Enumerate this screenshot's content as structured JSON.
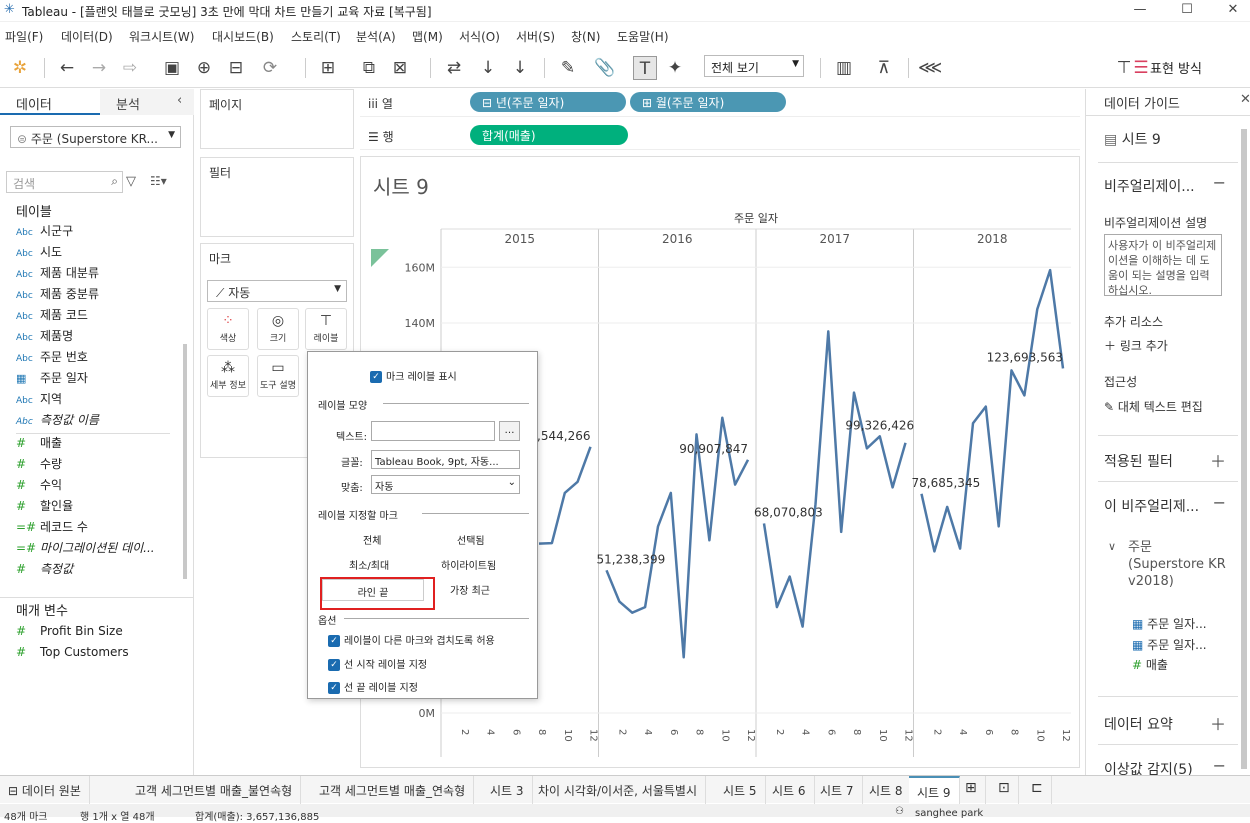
{
  "window": {
    "title": "Tableau - [플랜잇 태블로 굿모닝] 3초 만에 막대 차트 만들기 교육 자료 [복구됨]",
    "minimize": "—",
    "maximize": "☐",
    "close": "✕"
  },
  "menu": [
    "파일(F)",
    "데이터(D)",
    "워크시트(W)",
    "대시보드(B)",
    "스토리(T)",
    "분석(A)",
    "맵(M)",
    "서식(O)",
    "서버(S)",
    "창(N)",
    "도움말(H)"
  ],
  "toolbar": {
    "view_select": "전체 보기",
    "presentation": "표현 방식"
  },
  "left": {
    "tab_data": "데이터",
    "tab_analysis": "분석",
    "datasource": "주문 (Superstore KR...",
    "search_placeholder": "검색",
    "tables_header": "테이블",
    "fields": [
      {
        "type": "Abc",
        "name": "시군구"
      },
      {
        "type": "Abc",
        "name": "시도"
      },
      {
        "type": "Abc",
        "name": "제품 대분류"
      },
      {
        "type": "Abc",
        "name": "제품 중분류"
      },
      {
        "type": "Abc",
        "name": "제품 코드"
      },
      {
        "type": "Abc",
        "name": "제품명"
      },
      {
        "type": "Abc",
        "name": "주문 번호"
      },
      {
        "type": "cal",
        "name": "주문 일자"
      },
      {
        "type": "Abc",
        "name": "지역"
      },
      {
        "type": "Abc",
        "name": "측정값 이름"
      },
      {
        "type": "#",
        "name": "매출"
      },
      {
        "type": "#",
        "name": "수량"
      },
      {
        "type": "#",
        "name": "수익"
      },
      {
        "type": "#",
        "name": "할인율"
      },
      {
        "type": "=#",
        "name": "레코드 수"
      },
      {
        "type": "=#",
        "name": "마이그레이션된 데이..."
      },
      {
        "type": "#",
        "name": "측정값"
      }
    ],
    "params_header": "매개 변수",
    "params": [
      "Profit Bin Size",
      "Top Customers"
    ]
  },
  "panels": {
    "pages": "페이지",
    "filters": "필터",
    "marks": "마크",
    "mark_type": "자동",
    "mark_buttons": [
      "색상",
      "크기",
      "레이블",
      "세부 정보",
      "도구 설명"
    ]
  },
  "shelves": {
    "columns_label": "열",
    "rows_label": "행",
    "columns_pills": [
      "년(주문 일자)",
      "월(주문 일자)"
    ],
    "rows_pills": [
      "합계(매출)"
    ]
  },
  "sheet": {
    "title": "시트 9"
  },
  "popup": {
    "show_labels": "마크 레이블 표시",
    "appearance_header": "레이블 모양",
    "text_label": "텍스트:",
    "font_label": "글꼴:",
    "font_value": "Tableau Book, 9pt, 자동...",
    "align_label": "맞춤:",
    "align_value": "자동",
    "marks_header": "레이블 지정할 마크",
    "opt_all": "전체",
    "opt_selected": "선택됨",
    "opt_minmax": "최소/최대",
    "opt_highlighted": "하이라이트됨",
    "opt_lineend": "라인 끝",
    "opt_recent": "가장 최근",
    "options_header": "옵션",
    "opt1": "레이블이 다른 마크와 겹치도록 허용",
    "opt2": "선 시작 레이블 지정",
    "opt3": "선 끝 레이블 지정"
  },
  "right": {
    "title": "데이터 가이드",
    "sheet_name": "시트 9",
    "viz_header": "비주얼리제이...",
    "desc_label": "비주얼리제이션 설명",
    "desc_text": "사용자가 이 비주얼리제이션을 이해하는 데 도움이 되는 설명을 입력하십시오.",
    "resources_label": "추가 리소스",
    "add_link": "링크 추가",
    "access_label": "접근성",
    "alt_text": "대체 텍스트 편집",
    "applied_filters": "적용된 필터",
    "this_viz": "이 비주얼리제...",
    "ds_name": "주문 (Superstore KR v2018)",
    "ds_fields": [
      "주문 일자...",
      "주문 일자...",
      "매출"
    ],
    "data_summary": "데이터 요약",
    "outliers": "이상값 감지(5)"
  },
  "bottom_tabs": [
    "데이터 원본",
    "고객 세그먼트별 매출_불연속형",
    "고객 세그먼트별 매출_연속형",
    "시트 3",
    "차이 시각화/이서준, 서울특별시",
    "시트 5",
    "시트 6",
    "시트 7",
    "시트 8",
    "시트 9"
  ],
  "status": {
    "marks": "48개 마크",
    "rows": "행 1개 x 열 48개",
    "sum": "합계(매출): 3,657,136,885",
    "user": "sanghee park"
  },
  "colors": {
    "line": "#4e79a7",
    "pill_dim": "#4b97b3",
    "pill_measure": "#00b07d",
    "highlight_box": "#e02020",
    "checkbox": "#1a6bb0"
  },
  "chart_data": {
    "type": "line",
    "title": "시트 9",
    "xlabel": "주문 일자",
    "years": [
      "2015",
      "2016",
      "2017",
      "2018"
    ],
    "month_ticks": [
      "2",
      "4",
      "6",
      "8",
      "10",
      "12"
    ],
    "y_ticks": [
      "0M",
      "140M",
      "160M"
    ],
    "ylim": [
      0,
      168000000
    ],
    "series": [
      {
        "values": [
          [
            null,
            null,
            null,
            null,
            null,
            null,
            null,
            60800000,
            61000000,
            79000000,
            83000000,
            95544266
          ],
          [
            51238399,
            40000000,
            36000000,
            38000000,
            67000000,
            79000000,
            20000000,
            100000000,
            62000000,
            106000000,
            82000000,
            90907847
          ],
          [
            68070803,
            38000000,
            49000000,
            31000000,
            75000000,
            137000000,
            65000000,
            115000000,
            95000000,
            99326426,
            81000000,
            97000000
          ],
          [
            78685345,
            58000000,
            74000000,
            59000000,
            104000000,
            110000000,
            67000000,
            123000000,
            114000000,
            145000000,
            159000000,
            123693563
          ]
        ]
      }
    ],
    "data_labels": [
      {
        "year": 0,
        "month": 12,
        "text": "95,544,266"
      },
      {
        "year": 1,
        "month": 1,
        "text": "51,238,399"
      },
      {
        "year": 1,
        "month": 12,
        "text": "90,907,847"
      },
      {
        "year": 2,
        "month": 1,
        "text": "68,070,803"
      },
      {
        "year": 2,
        "month": 10,
        "text": "99,326,426"
      },
      {
        "year": 3,
        "month": 1,
        "text": "78,685,345"
      },
      {
        "year": 3,
        "month": 12,
        "text": "123,693,563"
      }
    ]
  }
}
